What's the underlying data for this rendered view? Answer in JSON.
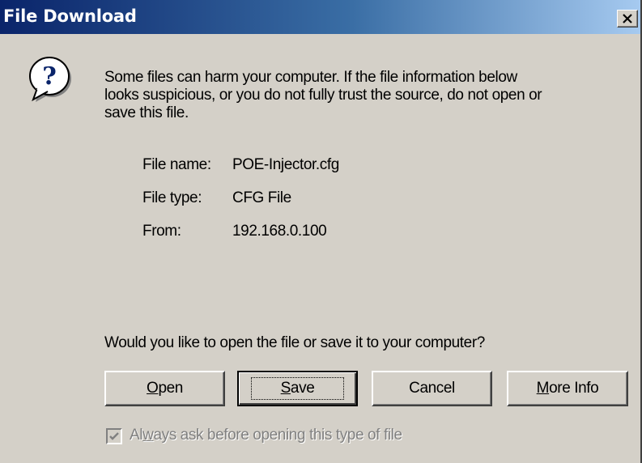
{
  "window": {
    "title": "File Download",
    "close_label": "×"
  },
  "icon": {
    "name": "question-icon",
    "glyph": "?"
  },
  "warning_text": "Some files can harm your computer. If the file information below\nlooks suspicious, or you do not fully trust the source, do not open or\nsave this file.",
  "file_info": {
    "name_label": "File name:",
    "name_value": "POE-Injector.cfg",
    "type_label": "File type:",
    "type_value": "CFG File",
    "from_label": "From:",
    "from_value": "192.168.0.100"
  },
  "question": "Would you like to open the file or save it to your computer?",
  "buttons": {
    "open": {
      "mnemonic": "O",
      "rest": "pen"
    },
    "save": {
      "mnemonic": "S",
      "rest": "ave"
    },
    "cancel": "Cancel",
    "more_info": {
      "mnemonic": "M",
      "rest": "ore Info"
    }
  },
  "checkbox": {
    "checked": true,
    "label_pre": "Al",
    "mnemonic": "w",
    "label_post": "ays ask before opening this type of file"
  },
  "colors": {
    "title_start": "#0a246a",
    "title_end": "#a6caf0",
    "face": "#d4d0c8",
    "disabled_text": "#808080"
  }
}
